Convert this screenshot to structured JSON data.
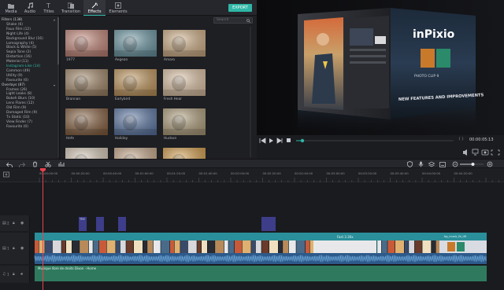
{
  "tabs": [
    {
      "label": "Media",
      "icon": "folder-icon"
    },
    {
      "label": "Audio",
      "icon": "note-icon"
    },
    {
      "label": "Titles",
      "icon": "text-icon"
    },
    {
      "label": "Transition",
      "icon": "transition-icon"
    },
    {
      "label": "Effects",
      "icon": "effects-icon",
      "active": true
    },
    {
      "label": "Elements",
      "icon": "elements-icon"
    }
  ],
  "export_label": "EXPORT",
  "search_placeholder": "Search",
  "sidebar": {
    "items": [
      {
        "label": "Filters (138)",
        "kind": "hdr",
        "expanded": true
      },
      {
        "label": "Shake (6)",
        "kind": "sub"
      },
      {
        "label": "Faux Film (12)",
        "kind": "sub"
      },
      {
        "label": "Night Life (4)",
        "kind": "sub"
      },
      {
        "label": "Background Blur (16)",
        "kind": "sub"
      },
      {
        "label": "Lomography (4)",
        "kind": "sub"
      },
      {
        "label": "Black & White (5)",
        "kind": "sub"
      },
      {
        "label": "Sepia Tone (2)",
        "kind": "sub"
      },
      {
        "label": "Distortion (16)",
        "kind": "sub"
      },
      {
        "label": "Material (11)",
        "kind": "sub"
      },
      {
        "label": "Instagram-Like (14)",
        "kind": "sub",
        "selected": true
      },
      {
        "label": "Common (49)",
        "kind": "sub"
      },
      {
        "label": "Utility (9)",
        "kind": "sub"
      },
      {
        "label": "Favourite (0)",
        "kind": "sub"
      },
      {
        "label": "Overlays (87)",
        "kind": "hdr",
        "expanded": true
      },
      {
        "label": "Frames (26)",
        "kind": "sub"
      },
      {
        "label": "Light Leaks (8)",
        "kind": "sub"
      },
      {
        "label": "Bokeh Blurs (10)",
        "kind": "sub"
      },
      {
        "label": "Lens Flares (12)",
        "kind": "sub"
      },
      {
        "label": "Old Film (9)",
        "kind": "sub"
      },
      {
        "label": "Damaged Film (9)",
        "kind": "sub"
      },
      {
        "label": "Tv Static (10)",
        "kind": "sub"
      },
      {
        "label": "View Finder (7)",
        "kind": "sub"
      },
      {
        "label": "Favourite (0)",
        "kind": "sub"
      }
    ]
  },
  "effects": [
    {
      "label": "1977",
      "tint": "#c98a7c"
    },
    {
      "label": "Aegean",
      "tint": "#6f9ba8"
    },
    {
      "label": "Amaro",
      "tint": "#d6b48a"
    },
    {
      "label": "Brannan",
      "tint": "#a68a6a"
    },
    {
      "label": "Earlybird",
      "tint": "#c69a5e"
    },
    {
      "label": "Fresh Hear",
      "tint": "#e3c7a8"
    },
    {
      "label": "Hefe",
      "tint": "#8a6342"
    },
    {
      "label": "Holiday",
      "tint": "#5e7aa8"
    },
    {
      "label": "Hudson",
      "tint": "#b4a27e"
    },
    {
      "label": "",
      "tint": "#d9cbb8"
    },
    {
      "label": "",
      "tint": "#c9a98a"
    },
    {
      "label": "",
      "tint": "#d8a04a"
    }
  ],
  "preview": {
    "logo_text": "inPixio",
    "product": "PHOTO CLIP 9",
    "headline": "NEW FEATURES AND IMPROVEMENTS",
    "progress": 0.04,
    "timecode": "00:00:05:13",
    "brackets": "{ }"
  },
  "ruler": {
    "labels": [
      "00:00:00:00",
      "00:00:20:00",
      "00:00:40:00",
      "00:01:00:00",
      "00:01:20:00",
      "00:01:40:00",
      "00:02:00:00",
      "00:02:20:00",
      "00:02:40:00",
      "00:03:00:00",
      "00:03:20:00",
      "00:03:40:00",
      "00:04:00:00",
      "00:04:20:00"
    ]
  },
  "timeline": {
    "fast_label": "Fast 3.30x",
    "fx_label": "TRE",
    "audio_label": "Musique libre de droits Dixon - Home",
    "end_clip_label": "bg_music_fb_UK",
    "track_labels": [
      "2",
      "1",
      "1"
    ],
    "zoom": 0.55
  },
  "colors": {
    "accent": "#2fb6a6",
    "playhead": "#e8414e",
    "video_track": "#2a8f9a",
    "audio_track": "#2f7a5f",
    "fx_clip": "#3d3d8a"
  }
}
